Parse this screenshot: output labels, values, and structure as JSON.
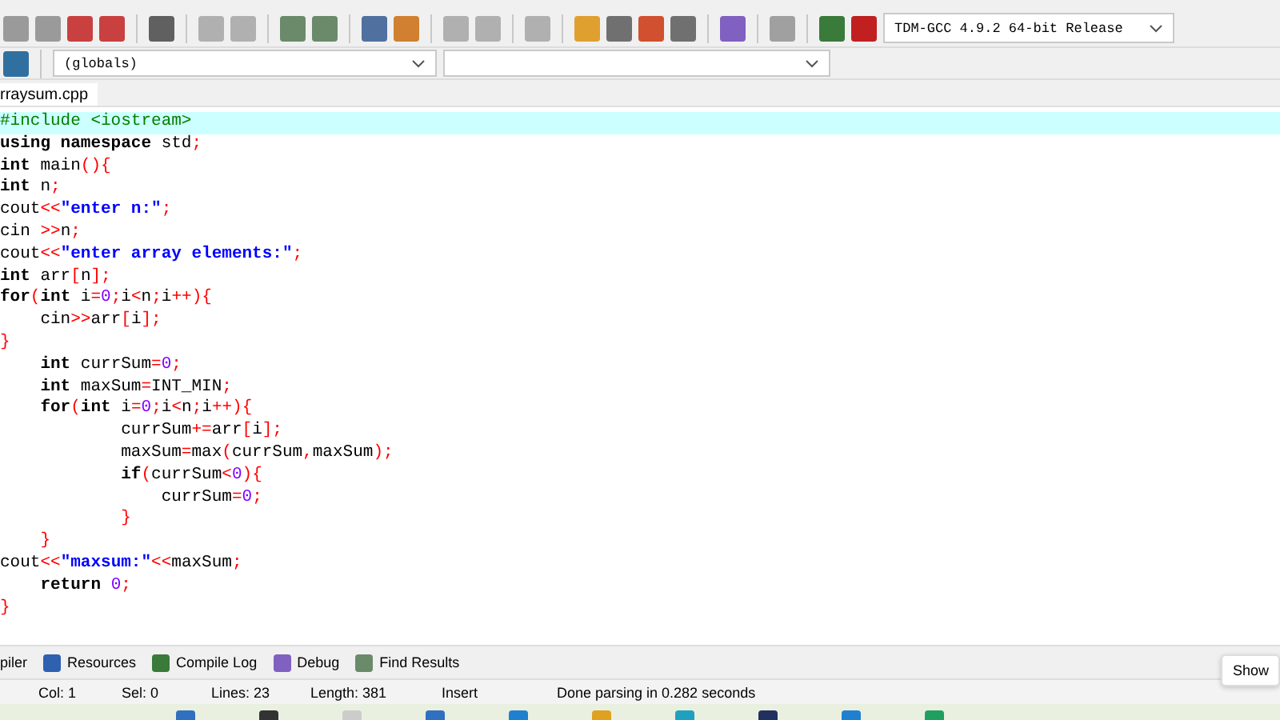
{
  "toolbar": {
    "compiler": "TDM-GCC 4.9.2 64-bit Release"
  },
  "scope_bar": {
    "scope": "(globals)"
  },
  "file_tab": "rraysum.cpp",
  "code": [
    [
      {
        "kind": "pre",
        "text": "#include <iostream>"
      }
    ],
    [
      {
        "kind": "kw",
        "text": "using namespace"
      },
      {
        "kind": "plain",
        "text": " std"
      },
      {
        "kind": "sym",
        "text": ";"
      }
    ],
    [
      {
        "kind": "kw",
        "text": "int"
      },
      {
        "kind": "plain",
        "text": " main"
      },
      {
        "kind": "sym",
        "text": "(){"
      }
    ],
    [
      {
        "kind": "kw",
        "text": "int"
      },
      {
        "kind": "plain",
        "text": " n"
      },
      {
        "kind": "sym",
        "text": ";"
      }
    ],
    [
      {
        "kind": "plain",
        "text": "cout"
      },
      {
        "kind": "sym",
        "text": "<<"
      },
      {
        "kind": "str",
        "text": "\"enter n:\""
      },
      {
        "kind": "sym",
        "text": ";"
      }
    ],
    [
      {
        "kind": "plain",
        "text": "cin "
      },
      {
        "kind": "sym",
        "text": ">>"
      },
      {
        "kind": "plain",
        "text": "n"
      },
      {
        "kind": "sym",
        "text": ";"
      }
    ],
    [
      {
        "kind": "plain",
        "text": "cout"
      },
      {
        "kind": "sym",
        "text": "<<"
      },
      {
        "kind": "str",
        "text": "\"enter array elements:\""
      },
      {
        "kind": "sym",
        "text": ";"
      }
    ],
    [
      {
        "kind": "kw",
        "text": "int"
      },
      {
        "kind": "plain",
        "text": " arr"
      },
      {
        "kind": "sym",
        "text": "["
      },
      {
        "kind": "plain",
        "text": "n"
      },
      {
        "kind": "sym",
        "text": "];"
      }
    ],
    [
      {
        "kind": "kw",
        "text": "for"
      },
      {
        "kind": "sym",
        "text": "("
      },
      {
        "kind": "kw",
        "text": "int"
      },
      {
        "kind": "plain",
        "text": " i"
      },
      {
        "kind": "sym",
        "text": "="
      },
      {
        "kind": "num",
        "text": "0"
      },
      {
        "kind": "sym",
        "text": ";"
      },
      {
        "kind": "plain",
        "text": "i"
      },
      {
        "kind": "sym",
        "text": "<"
      },
      {
        "kind": "plain",
        "text": "n"
      },
      {
        "kind": "sym",
        "text": ";"
      },
      {
        "kind": "plain",
        "text": "i"
      },
      {
        "kind": "sym",
        "text": "++){"
      }
    ],
    [
      {
        "kind": "plain",
        "text": "    cin"
      },
      {
        "kind": "sym",
        "text": ">>"
      },
      {
        "kind": "plain",
        "text": "arr"
      },
      {
        "kind": "sym",
        "text": "["
      },
      {
        "kind": "plain",
        "text": "i"
      },
      {
        "kind": "sym",
        "text": "];"
      }
    ],
    [
      {
        "kind": "sym",
        "text": "}"
      }
    ],
    [
      {
        "kind": "kw",
        "text": "    int"
      },
      {
        "kind": "plain",
        "text": " currSum"
      },
      {
        "kind": "sym",
        "text": "="
      },
      {
        "kind": "num",
        "text": "0"
      },
      {
        "kind": "sym",
        "text": ";"
      }
    ],
    [
      {
        "kind": "kw",
        "text": "    int"
      },
      {
        "kind": "plain",
        "text": " maxSum"
      },
      {
        "kind": "sym",
        "text": "="
      },
      {
        "kind": "plain",
        "text": "INT_MIN"
      },
      {
        "kind": "sym",
        "text": ";"
      }
    ],
    [
      {
        "kind": "kw",
        "text": "    for"
      },
      {
        "kind": "sym",
        "text": "("
      },
      {
        "kind": "kw",
        "text": "int"
      },
      {
        "kind": "plain",
        "text": " i"
      },
      {
        "kind": "sym",
        "text": "="
      },
      {
        "kind": "num",
        "text": "0"
      },
      {
        "kind": "sym",
        "text": ";"
      },
      {
        "kind": "plain",
        "text": "i"
      },
      {
        "kind": "sym",
        "text": "<"
      },
      {
        "kind": "plain",
        "text": "n"
      },
      {
        "kind": "sym",
        "text": ";"
      },
      {
        "kind": "plain",
        "text": "i"
      },
      {
        "kind": "sym",
        "text": "++){"
      }
    ],
    [
      {
        "kind": "plain",
        "text": "            currSum"
      },
      {
        "kind": "sym",
        "text": "+="
      },
      {
        "kind": "plain",
        "text": "arr"
      },
      {
        "kind": "sym",
        "text": "["
      },
      {
        "kind": "plain",
        "text": "i"
      },
      {
        "kind": "sym",
        "text": "];"
      }
    ],
    [
      {
        "kind": "plain",
        "text": "            maxSum"
      },
      {
        "kind": "sym",
        "text": "="
      },
      {
        "kind": "plain",
        "text": "max"
      },
      {
        "kind": "sym",
        "text": "("
      },
      {
        "kind": "plain",
        "text": "currSum"
      },
      {
        "kind": "sym",
        "text": ","
      },
      {
        "kind": "plain",
        "text": "maxSum"
      },
      {
        "kind": "sym",
        "text": ");"
      }
    ],
    [
      {
        "kind": "kw",
        "text": "            if"
      },
      {
        "kind": "sym",
        "text": "("
      },
      {
        "kind": "plain",
        "text": "currSum"
      },
      {
        "kind": "sym",
        "text": "<"
      },
      {
        "kind": "num",
        "text": "0"
      },
      {
        "kind": "sym",
        "text": "){"
      }
    ],
    [
      {
        "kind": "plain",
        "text": "                currSum"
      },
      {
        "kind": "sym",
        "text": "="
      },
      {
        "kind": "num",
        "text": "0"
      },
      {
        "kind": "sym",
        "text": ";"
      }
    ],
    [
      {
        "kind": "sym",
        "text": "            }"
      }
    ],
    [
      {
        "kind": "sym",
        "text": "    }"
      }
    ],
    [
      {
        "kind": "plain",
        "text": "cout"
      },
      {
        "kind": "sym",
        "text": "<<"
      },
      {
        "kind": "str",
        "text": "\"maxsum:\""
      },
      {
        "kind": "sym",
        "text": "<<"
      },
      {
        "kind": "plain",
        "text": "maxSum"
      },
      {
        "kind": "sym",
        "text": ";"
      }
    ],
    [
      {
        "kind": "kw",
        "text": "    return"
      },
      {
        "kind": "num",
        "text": " 0"
      },
      {
        "kind": "sym",
        "text": ";"
      }
    ],
    [
      {
        "kind": "sym",
        "text": "}"
      }
    ]
  ],
  "bottom_tabs": [
    "piler",
    "Resources",
    "Compile Log",
    "Debug",
    "Find Results"
  ],
  "status_bar": [
    {
      "label": "Col:",
      "value": "1"
    },
    {
      "label": "Sel:",
      "value": "0"
    },
    {
      "label": "Lines:",
      "value": "23"
    },
    {
      "label": "Length:",
      "value": "381"
    },
    {
      "label": "Insert"
    },
    {
      "label": "Done parsing in 0.282 seconds"
    }
  ],
  "tooltip": "Show"
}
